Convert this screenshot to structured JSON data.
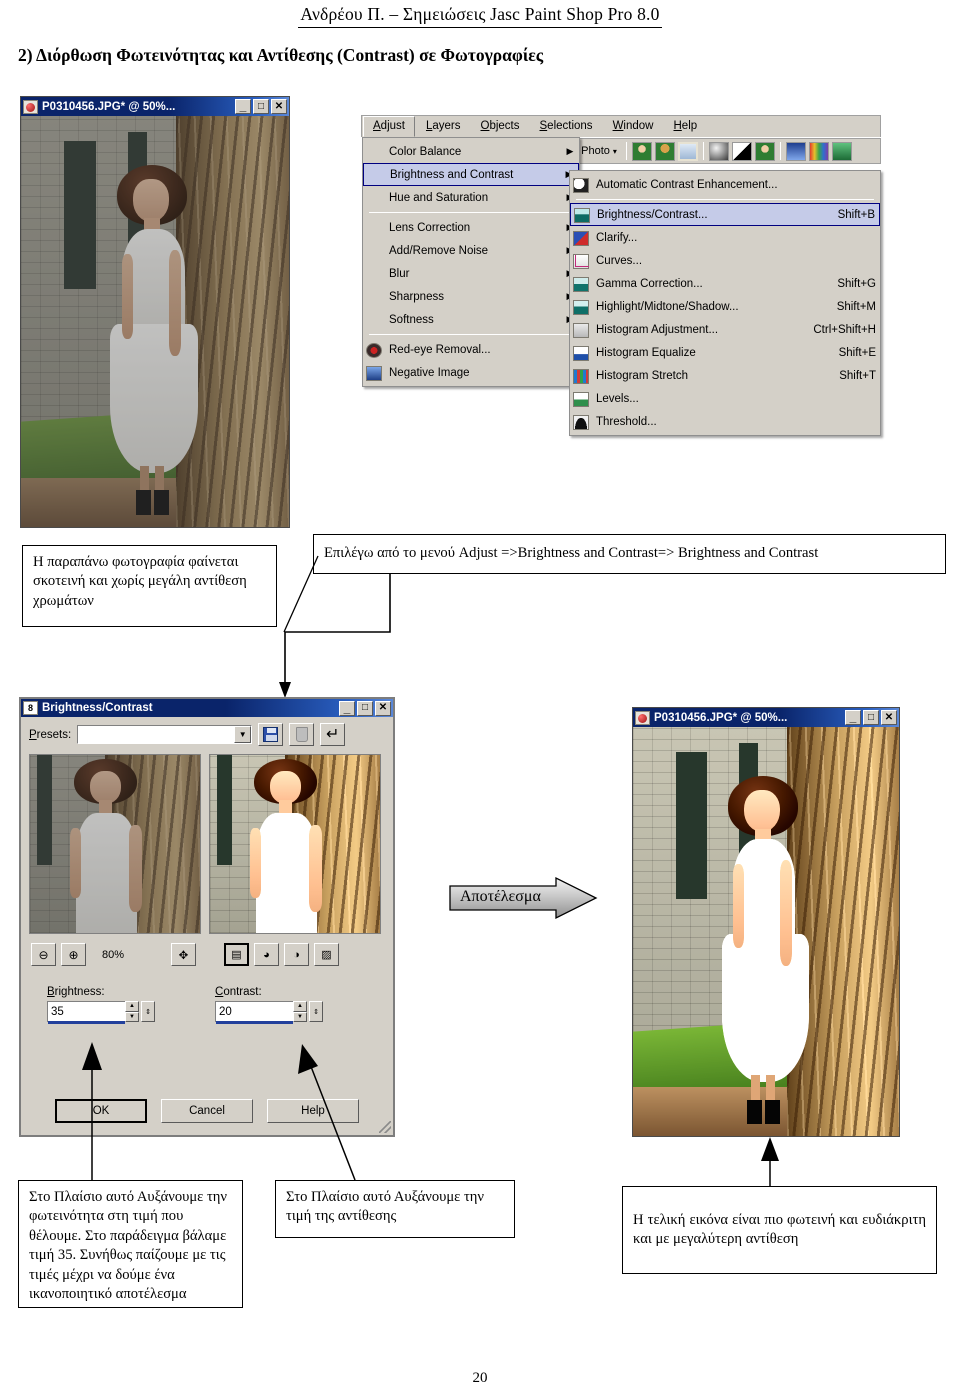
{
  "document": {
    "header": "Ανδρέου Π.  –  Σημειώσεις Jasc Paint Shop Pro 8.0",
    "section_title": "2) Διόρθωση Φωτεινότητας και Αντίθεσης (Contrast) σε Φωτογραφίες",
    "page_number": "20"
  },
  "photo_window_before": {
    "title": "P0310456.JPG* @ 50%...",
    "icon": "psp-red-ball-icon",
    "buttons": {
      "minimize": "_",
      "maximize": "□",
      "close": "✕"
    }
  },
  "photo_window_after": {
    "title": "P0310456.JPG* @ 50%...",
    "icon": "psp-red-ball-icon",
    "buttons": {
      "minimize": "_",
      "maximize": "□",
      "close": "✕"
    }
  },
  "menubar": {
    "items": [
      {
        "label": "Adjust",
        "mnemonic": "A",
        "active": true
      },
      {
        "label": "Layers",
        "mnemonic": "L",
        "active": false
      },
      {
        "label": "Objects",
        "mnemonic": "O",
        "active": false
      },
      {
        "label": "Selections",
        "mnemonic": "S",
        "active": false
      },
      {
        "label": "Window",
        "mnemonic": "W",
        "active": false
      },
      {
        "label": "Help",
        "mnemonic": "H",
        "active": false
      }
    ]
  },
  "toolbar": {
    "dropdown_label": "e Photo",
    "caret": "▾",
    "icons": [
      "person-green-icon",
      "person-gold-icon",
      "portrait-frame-icon",
      "sphere-shading-icon",
      "contrast-triangle-icon",
      "photo-person-icon",
      "histogram-icon",
      "rainbow-gradient-icon",
      "green-gradient-icon"
    ]
  },
  "adjust_menu": {
    "items": [
      {
        "label": "Color Balance",
        "mnemonic": "C",
        "submenu": true,
        "selected": false,
        "icon": null
      },
      {
        "label": "Brightness and Contrast",
        "mnemonic": "B",
        "submenu": true,
        "selected": true,
        "icon": null
      },
      {
        "label": "Hue and Saturation",
        "mnemonic": "H",
        "submenu": true,
        "selected": false,
        "icon": null
      },
      {
        "separator": true
      },
      {
        "label": "Lens Correction",
        "mnemonic": "L",
        "submenu": true,
        "selected": false,
        "icon": null
      },
      {
        "label": "Add/Remove Noise",
        "mnemonic": "N",
        "submenu": true,
        "selected": false,
        "icon": null
      },
      {
        "label": "Blur",
        "mnemonic": "u",
        "submenu": true,
        "selected": false,
        "icon": null
      },
      {
        "label": "Sharpness",
        "mnemonic": "S",
        "submenu": true,
        "selected": false,
        "icon": null
      },
      {
        "label": "Softness",
        "mnemonic": "f",
        "submenu": true,
        "selected": false,
        "icon": null
      },
      {
        "separator": true
      },
      {
        "label": "Red-eye Removal...",
        "mnemonic": "y",
        "submenu": false,
        "selected": false,
        "icon": "red-eye-icon"
      },
      {
        "label": "Negative Image",
        "mnemonic": "g",
        "submenu": false,
        "selected": false,
        "icon": "negative-image-icon"
      }
    ]
  },
  "brightness_contrast_submenu": {
    "items": [
      {
        "label": "Automatic Contrast Enhancement...",
        "accel": "",
        "selected": false,
        "icon": "auto-contrast-icon"
      },
      {
        "separator": true
      },
      {
        "label": "Brightness/Contrast...",
        "accel": "Shift+B",
        "selected": true,
        "icon": "brightness-contrast-icon"
      },
      {
        "label": "Clarify...",
        "accel": "",
        "selected": false,
        "icon": "clarify-icon"
      },
      {
        "label": "Curves...",
        "accel": "",
        "selected": false,
        "icon": "curves-icon"
      },
      {
        "label": "Gamma Correction...",
        "accel": "Shift+G",
        "selected": false,
        "icon": "gamma-correction-icon"
      },
      {
        "label": "Highlight/Midtone/Shadow...",
        "accel": "Shift+M",
        "selected": false,
        "icon": "highlight-midtone-shadow-icon"
      },
      {
        "label": "Histogram Adjustment...",
        "accel": "Ctrl+Shift+H",
        "selected": false,
        "icon": "histogram-adjustment-icon"
      },
      {
        "label": "Histogram Equalize",
        "accel": "Shift+E",
        "selected": false,
        "icon": "histogram-equalize-icon"
      },
      {
        "label": "Histogram Stretch",
        "accel": "Shift+T",
        "selected": false,
        "icon": "histogram-stretch-icon"
      },
      {
        "label": "Levels...",
        "accel": "",
        "selected": false,
        "icon": "levels-icon"
      },
      {
        "label": "Threshold...",
        "accel": "",
        "selected": false,
        "icon": "threshold-icon"
      }
    ]
  },
  "bc_dialog": {
    "title": "Brightness/Contrast",
    "icon": "bc-dialog-icon",
    "presets_label": "Presets:",
    "presets_value": "",
    "save_preset_icon": "save-preset-icon",
    "delete_preset_icon": "delete-preset-icon",
    "reset_icon": "reset-icon",
    "zoom_out_icon": "zoom-out-icon",
    "zoom_in_icon": "zoom-in-icon",
    "zoom_level": "80%",
    "pan_icon": "pan-icon",
    "proof_icon": "proof-icon",
    "auto_proof_icon": "auto-proof-icon",
    "preview_icon": "preview-eye-icon",
    "randomize_icon": "randomize-icon",
    "brightness_label": "Brightness:",
    "brightness_value": "35",
    "contrast_label": "Contrast:",
    "contrast_value": "20",
    "buttons": {
      "ok": "OK",
      "cancel": "Cancel",
      "help": "Help"
    }
  },
  "result_banner": {
    "label": "Αποτέλεσμα"
  },
  "captions": {
    "photo_dark": "Η παραπάνω φωτογραφία φαίνεται σκοτεινή και χωρίς μεγάλη αντίθεση χρωμάτων",
    "menu_path": "Επιλέγω από το μενού Adjust =>Brightness and Contrast=> Brightness and Contrast",
    "brightness_note": "Στο Πλαίσιο αυτό Αυξάνουμε την φωτεινότητα στη τιμή που θέλουμε. Στο παράδειγμα βάλαμε τιμή 35. Συνήθως παίζουμε με τις τιμές μέχρι να δούμε ένα ικανοποιητικό αποτέλεσμα",
    "contrast_note": "Στο Πλαίσιο αυτό Αυξάνουμε την τιμή της αντίθεσης",
    "final_note": "Η τελική εικόνα είναι πιο φωτεινή και ευδιάκριτη και με μεγαλύτερη αντίθεση"
  },
  "colors": {
    "title_bar_blue": "#0a246a",
    "window_face": "#d4d0c8",
    "menu_selection": "#c5cbe8",
    "menu_selection_border": "#000080",
    "spin_underline": "#22409c"
  }
}
